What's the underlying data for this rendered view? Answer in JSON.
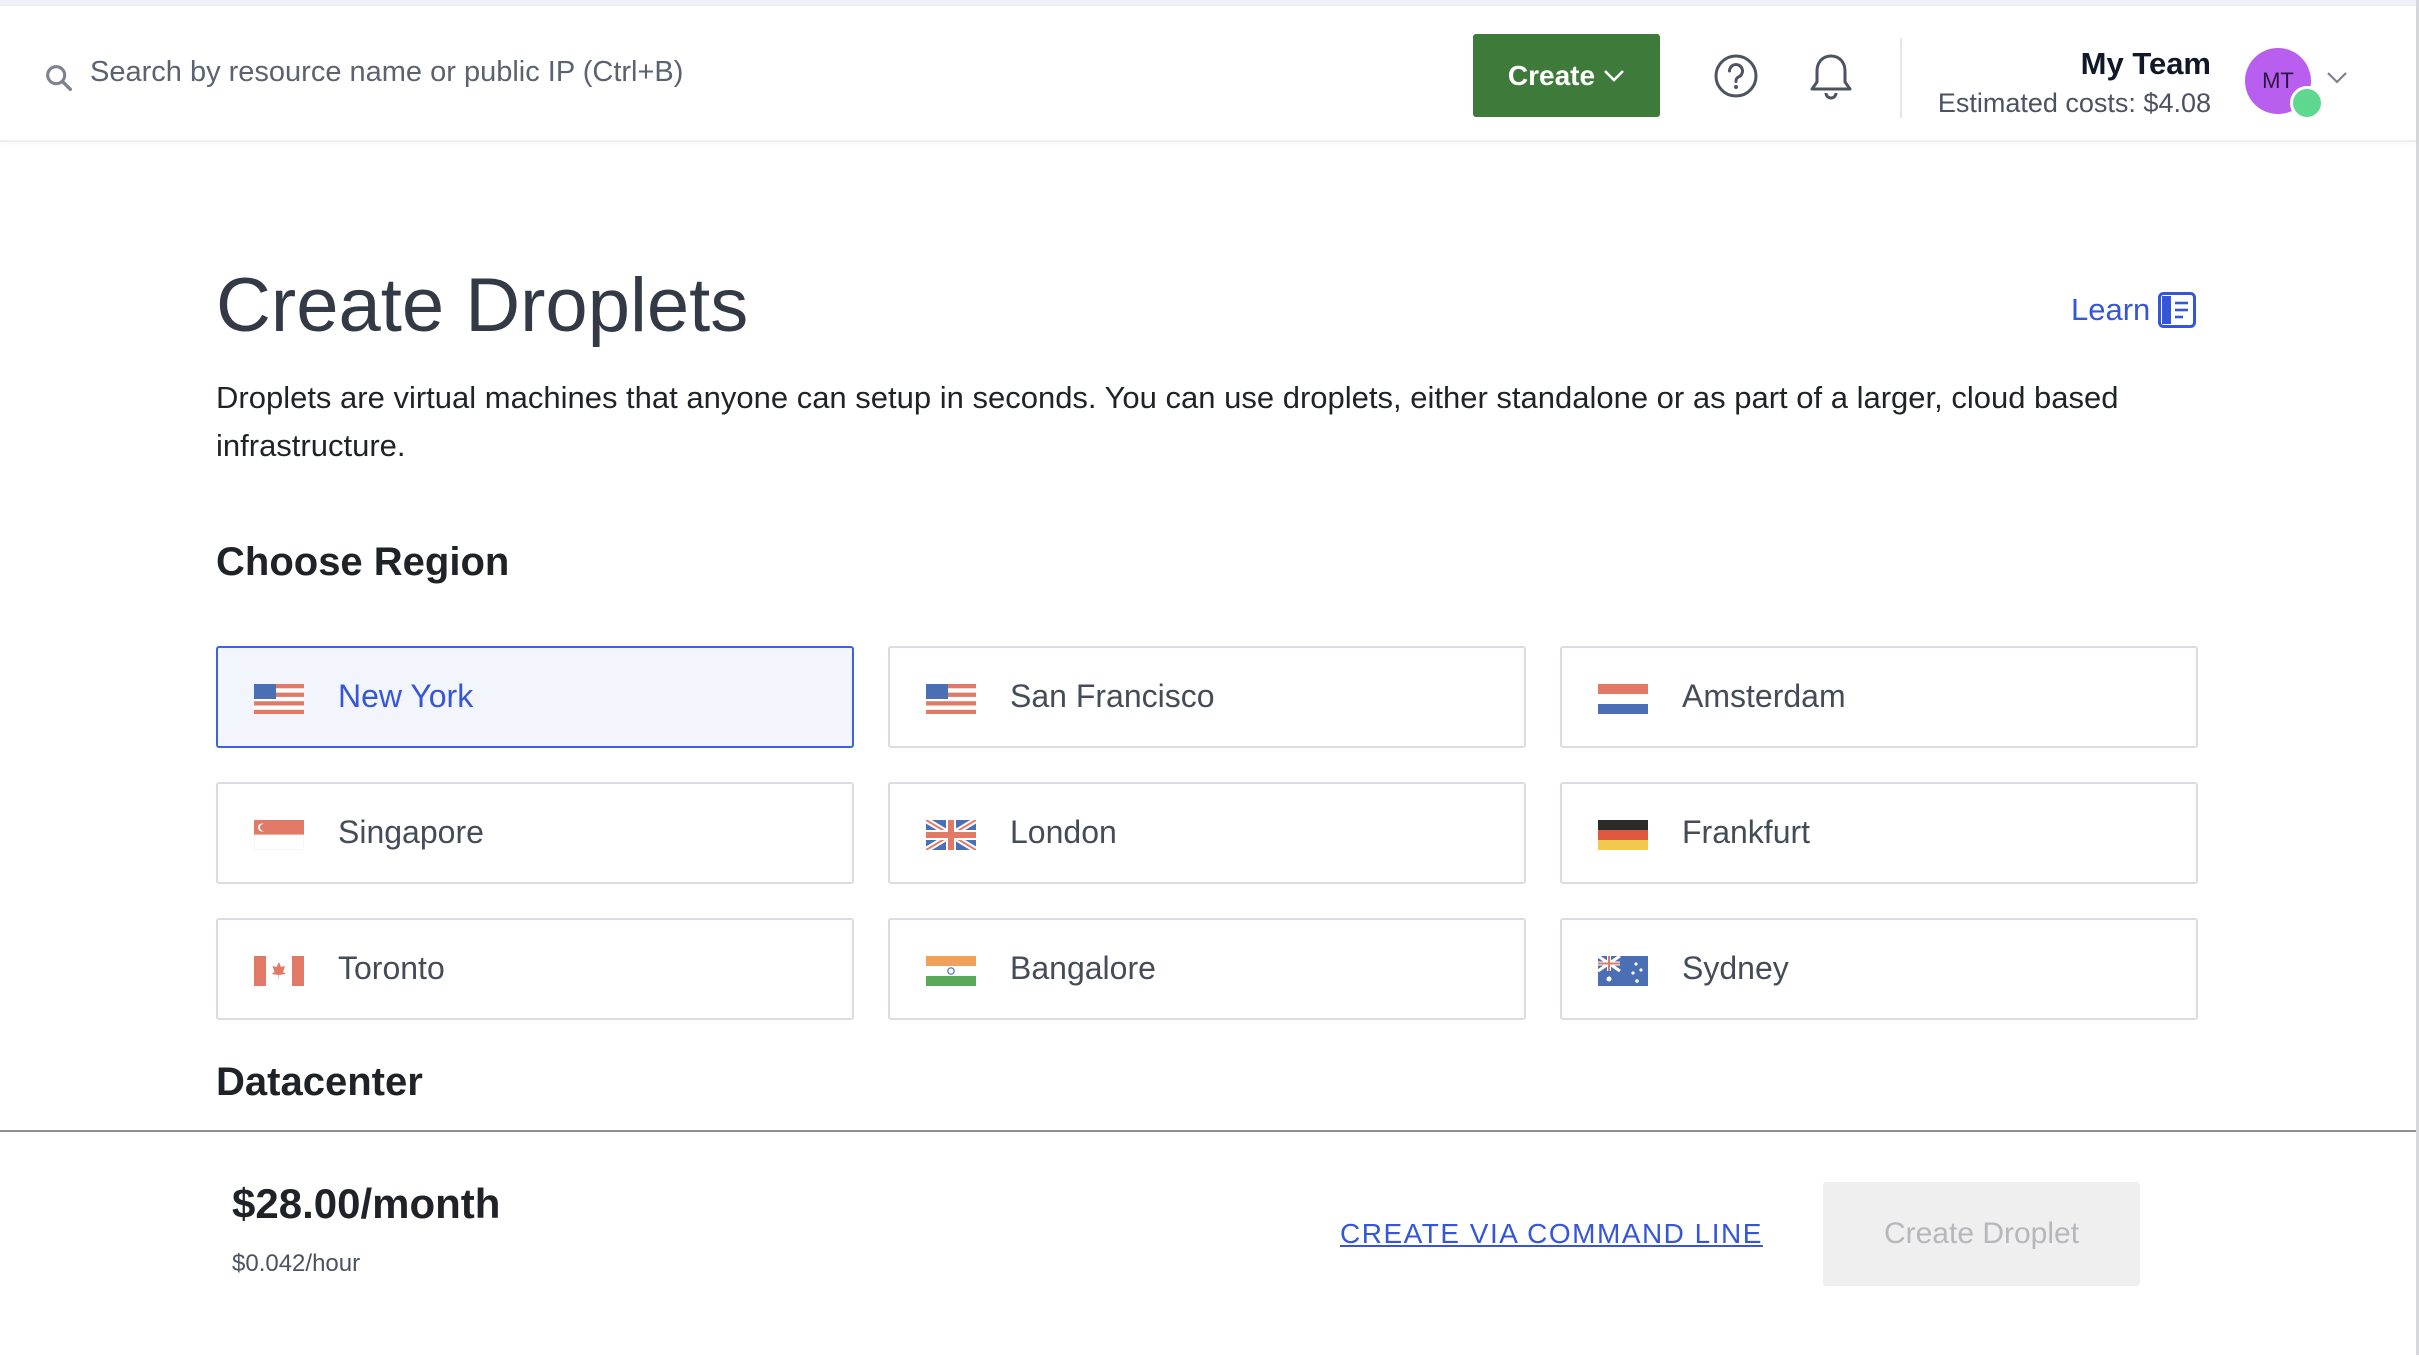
{
  "header": {
    "search_placeholder": "Search by resource name or public IP (Ctrl+B)",
    "create_button": "Create",
    "team_name": "My Team",
    "estimated_costs": "Estimated costs: $4.08",
    "avatar_initials": "MT"
  },
  "main": {
    "title": "Create Droplets",
    "learn_label": "Learn",
    "description": "Droplets are virtual machines that anyone can setup in seconds. You can use droplets, either standalone or as part of a larger, cloud based infrastructure.",
    "region_heading": "Choose Region",
    "regions": [
      {
        "label": "New York",
        "flag": "us-flag-icon",
        "selected": true
      },
      {
        "label": "San Francisco",
        "flag": "us-flag-icon",
        "selected": false
      },
      {
        "label": "Amsterdam",
        "flag": "nl-flag-icon",
        "selected": false
      },
      {
        "label": "Singapore",
        "flag": "sg-flag-icon",
        "selected": false
      },
      {
        "label": "London",
        "flag": "uk-flag-icon",
        "selected": false
      },
      {
        "label": "Frankfurt",
        "flag": "de-flag-icon",
        "selected": false
      },
      {
        "label": "Toronto",
        "flag": "ca-flag-icon",
        "selected": false
      },
      {
        "label": "Bangalore",
        "flag": "in-flag-icon",
        "selected": false
      },
      {
        "label": "Sydney",
        "flag": "au-flag-icon",
        "selected": false
      }
    ],
    "datacenter_heading": "Datacenter"
  },
  "footer": {
    "monthly_price": "$28.00/month",
    "hourly_price": "$0.042/hour",
    "cli_link": "CREATE VIA COMMAND LINE",
    "create_droplet_button": "Create Droplet"
  },
  "colors": {
    "accent_green": "#3e7b3a",
    "link_blue": "#3556d9",
    "selected_border": "#3e63dd",
    "avatar": "#b95ff0"
  }
}
